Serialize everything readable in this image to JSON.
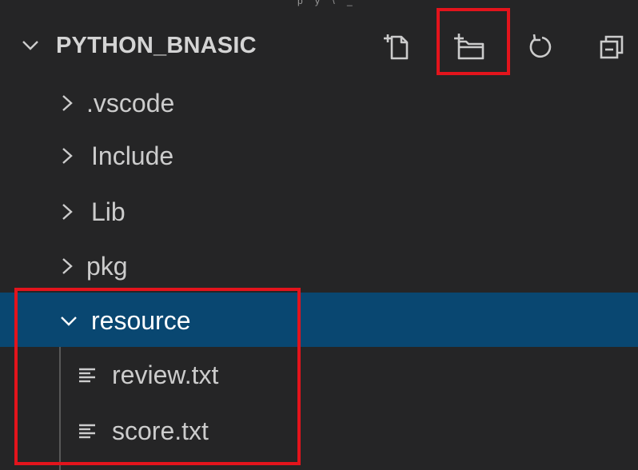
{
  "explorer": {
    "title": "PYTHON_BNASIC",
    "top_fragment": "p y \\ _"
  },
  "toolbar": {
    "new_file_icon": "new-file-icon",
    "new_folder_icon": "new-folder-icon",
    "refresh_icon": "refresh-icon",
    "collapse_all_icon": "collapse-all-icon"
  },
  "tree": {
    "folders": [
      {
        "label": ".vscode",
        "expanded": false
      },
      {
        "label": "Include",
        "expanded": false
      },
      {
        "label": "Lib",
        "expanded": false
      },
      {
        "label": "pkg",
        "expanded": false
      },
      {
        "label": "resource",
        "expanded": true,
        "selected": true
      }
    ],
    "files": [
      {
        "label": "review.txt"
      },
      {
        "label": "score.txt"
      }
    ]
  },
  "colors": {
    "background": "#252526",
    "selection": "#094771",
    "highlight_border": "#e3141c",
    "text": "#cccccc"
  }
}
